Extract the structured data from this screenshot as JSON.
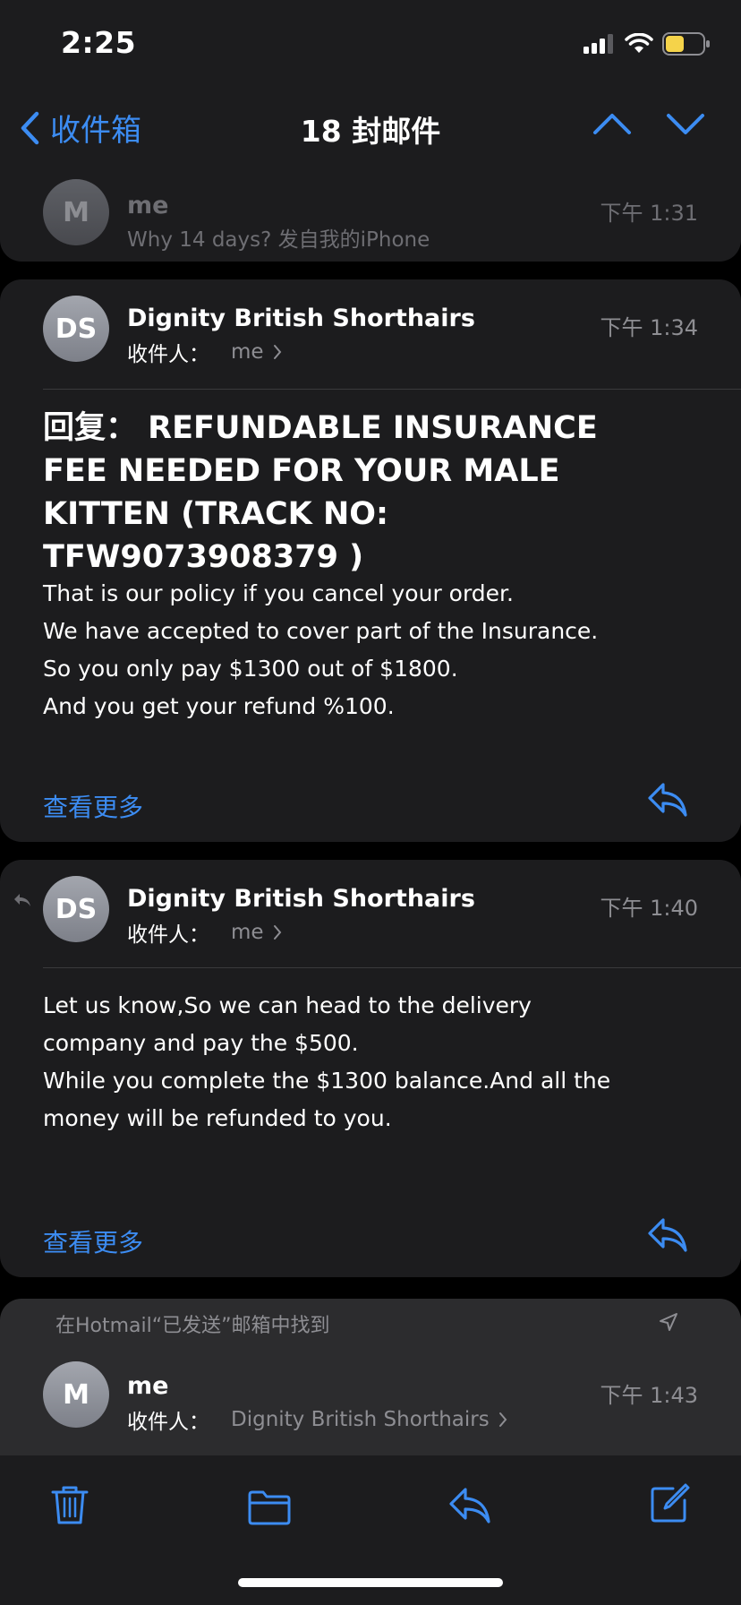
{
  "status": {
    "time": "2:25"
  },
  "nav": {
    "back_label": "收件箱",
    "title": "18 封邮件"
  },
  "messages": [
    {
      "avatar": "M",
      "sender": "me",
      "time": "下午 1:31",
      "preview": "Why 14 days? 发自我的iPhone"
    },
    {
      "avatar": "DS",
      "sender": "Dignity British Shorthairs",
      "to_label": "收件人：",
      "to_value": "me",
      "time": "下午 1:34",
      "subject": "回复： REFUNDABLE INSURANCE FEE NEEDED FOR YOUR MALE KITTEN (TRACK NO: TFW9073908379 )",
      "body": [
        "That is our policy if you cancel your order.",
        "We have accepted to cover part of the Insurance.",
        "So you only pay $1300 out of $1800.",
        "And you get your refund %100."
      ],
      "see_more": "查看更多"
    },
    {
      "avatar": "DS",
      "sender": "Dignity British Shorthairs",
      "to_label": "收件人：",
      "to_value": "me",
      "time": "下午 1:40",
      "body": [
        "Let us know,So we can head to the delivery",
        "company and pay the $500.",
        "While you complete the $1300 balance.And all the",
        "money will be refunded to you."
      ],
      "see_more": "查看更多"
    },
    {
      "avatar": "M",
      "sender": "me",
      "to_label": "收件人：",
      "to_value": "Dignity British Shorthairs",
      "time": "下午 1:43"
    }
  ],
  "found_banner": "在Hotmail“已发送”邮箱中找到",
  "colors": {
    "accent": "#3c8cf2",
    "card": "#1c1c1e",
    "background": "#000000",
    "secondary_text": "#8e8e93",
    "battery": "#f5d34a"
  },
  "icons": {
    "toolbar": [
      "trash-icon",
      "folder-icon",
      "reply-icon",
      "compose-icon"
    ]
  }
}
